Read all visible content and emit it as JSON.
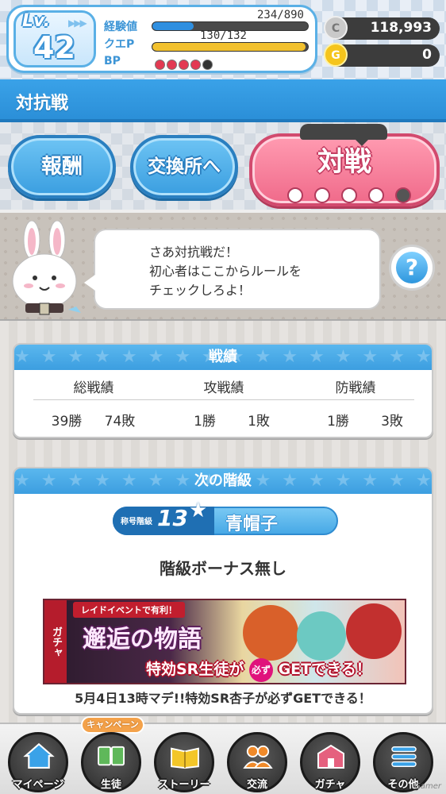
{
  "status": {
    "level_label": "Lv.",
    "level": "42",
    "exp_label": "経験値",
    "exp_value": "234/890",
    "exp_fraction": 0.263,
    "quest_label": "クエP",
    "quest_value": "130/132",
    "quest_fraction": 0.985,
    "bp_label": "BP",
    "bp_total": 5,
    "bp_filled": 4
  },
  "currency": {
    "coins": "118,993",
    "coin_symbol": "C",
    "gems": "0",
    "gem_symbol": "G"
  },
  "header": {
    "title": "対抗戦"
  },
  "actions": {
    "reward_label": "報酬",
    "exchange_label": "交換所へ",
    "battle_label": "対戦",
    "battle_stamina_total": 5,
    "battle_stamina_filled": 4
  },
  "mascot": {
    "line1": "さあ対抗戦だ！",
    "line2": "初心者はここからルールを",
    "line3": "チェックしろよ！",
    "help_symbol": "?"
  },
  "record": {
    "title": "戦績",
    "headers": [
      "総戦績",
      "攻戦績",
      "防戦績"
    ],
    "total": {
      "wins": "39勝",
      "losses": "74敗"
    },
    "attack": {
      "wins": "1勝",
      "losses": "1敗"
    },
    "defense": {
      "wins": "1勝",
      "losses": "3敗"
    }
  },
  "next_rank": {
    "title": "次の階級",
    "tag_small": "称号階級",
    "tag_number": "13",
    "rank_name": "青帽子",
    "bonus": "階級ボーナス無し"
  },
  "banner": {
    "gacha_tag": "ガチャ",
    "raid_text": "レイドイベントで有利！",
    "story_title": "邂逅の物語",
    "copy_prefix": "特効SR生徒が",
    "must_badge": "必ず",
    "copy_suffix": "GETできる！",
    "caption": "5月4日13時マデ!!特効SR杏子が必ずGETできる！"
  },
  "nav": {
    "campaign": "キャンペーン",
    "items": [
      {
        "label": "マイページ",
        "icon": "house-icon"
      },
      {
        "label": "生徒",
        "icon": "student-cards-icon"
      },
      {
        "label": "ストーリー",
        "icon": "book-icon"
      },
      {
        "label": "交流",
        "icon": "people-icon"
      },
      {
        "label": "ガチャ",
        "icon": "gacha-building-icon"
      },
      {
        "label": "その他",
        "icon": "menu-icon"
      }
    ]
  },
  "watermark": "Gamer",
  "colors": {
    "primary_blue": "#3aa2e8",
    "battle_pink": "#f06a8a",
    "bp_red": "#e33a52",
    "exp_blue": "#2f8fe0",
    "quest_yellow": "#f2c12e"
  }
}
